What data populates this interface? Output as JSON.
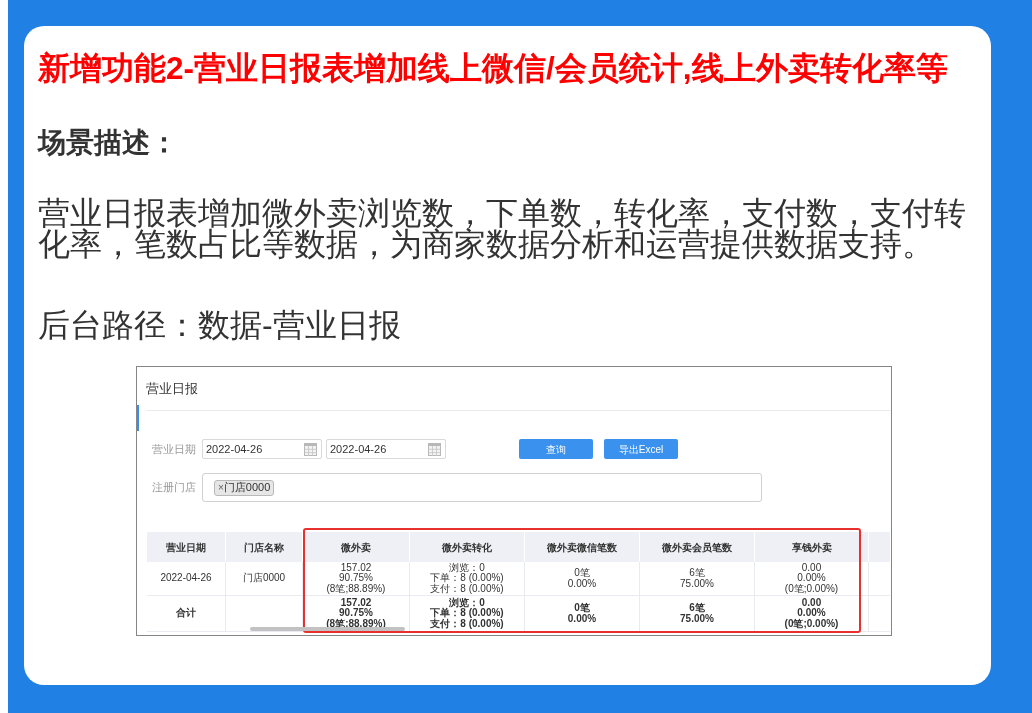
{
  "heading": "新增功能2-营业日报表增加线上微信/会员统计,线上外卖转化率等",
  "section_title": "场景描述：",
  "description": "营业日报表增加微外卖浏览数，下单数，转化率，支付数，支付转化率，笔数占比等数据，为商家数据分析和运营提供数据支持。",
  "path": "后台路径：数据-营业日报",
  "screenshot": {
    "title": "营业日报",
    "date_filter": {
      "label": "营业日期",
      "start": "2022-04-26",
      "end": "2022-04-26"
    },
    "buttons": [
      "查询",
      "导出Excel"
    ],
    "store_filter": {
      "label": "注册门店",
      "tags": [
        {
          "remove": "×",
          "label": "门店0000"
        }
      ]
    },
    "table": {
      "column_groups": [
        {
          "highlighted": false,
          "columns": [
            "营业日期",
            "门店名称"
          ]
        },
        {
          "highlighted": true,
          "columns": [
            "微外卖",
            "微外卖转化",
            "微外卖微信笔数",
            "微外卖会员笔数",
            "享钱外卖"
          ]
        }
      ],
      "rows": [
        {
          "kind": "data",
          "cells": [
            [
              "2022-04-26"
            ],
            [
              "门店0000"
            ],
            [
              "157.02",
              "90.75%",
              "(8笔;88.89%)"
            ],
            [
              "浏览：0",
              "下单：8 (0.00%)",
              "支付：8 (0.00%)"
            ],
            [
              "0笔",
              "0.00%"
            ],
            [
              "6笔",
              "75.00%"
            ],
            [
              "0.00",
              "0.00%",
              "(0笔;0.00%)"
            ]
          ]
        },
        {
          "kind": "total",
          "cells": [
            [
              "合计"
            ],
            null,
            [
              "157.02",
              "90.75%",
              "(8笔;88.89%)"
            ],
            [
              "浏览：0",
              "下单：8 (0.00%)",
              "支付：8 (0.00%)"
            ],
            [
              "0笔",
              "0.00%"
            ],
            [
              "6笔",
              "75.00%"
            ],
            [
              "0.00",
              "0.00%",
              "(0笔;0.00%)"
            ]
          ]
        }
      ]
    }
  }
}
